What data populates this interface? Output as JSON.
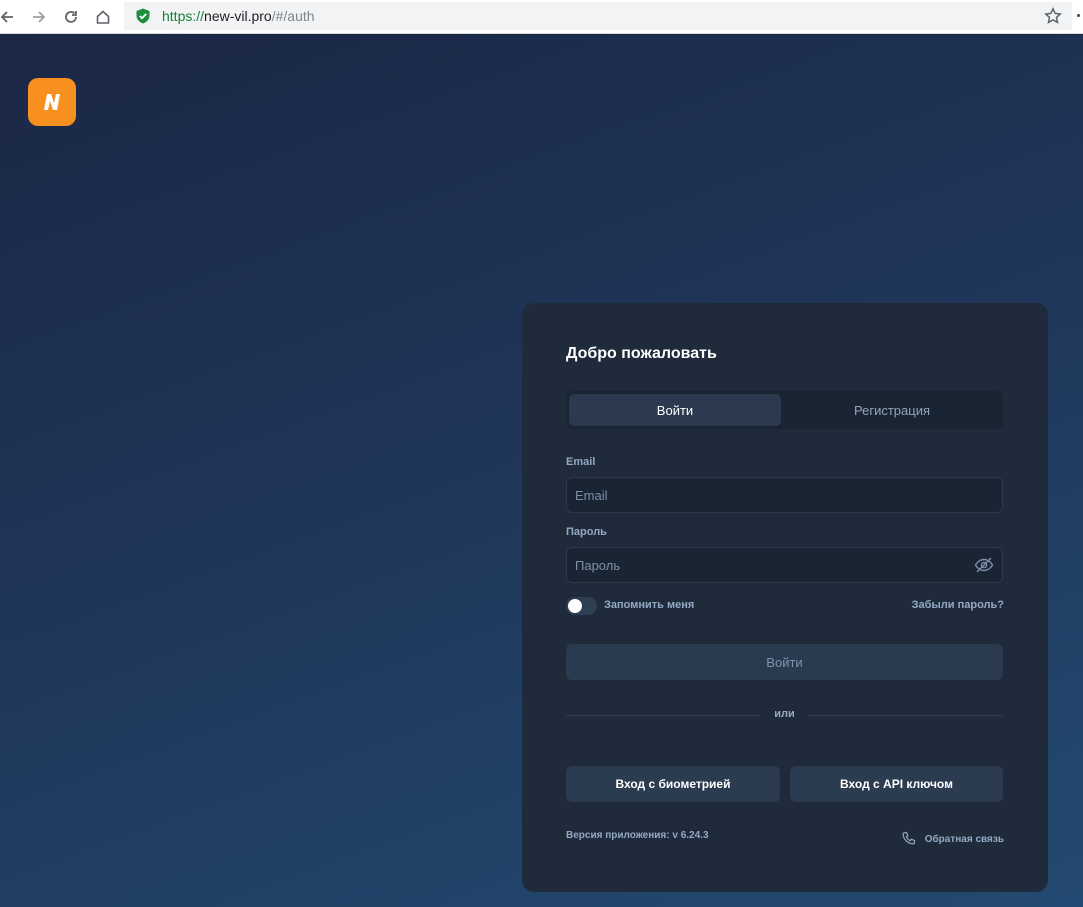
{
  "browser": {
    "url_scheme": "https://",
    "url_host": "new-vil.pro",
    "url_path": "/#/auth"
  },
  "auth": {
    "title": "Добро пожаловать",
    "tabs": {
      "login": "Войти",
      "register": "Регистрация"
    },
    "email_label": "Email",
    "email_placeholder": "Email",
    "password_label": "Пароль",
    "password_placeholder": "Пароль",
    "remember_label": "Запомнить меня",
    "remember_checked": false,
    "forgot_link": "Забыли пароль?",
    "submit_label": "Войти",
    "divider_text": "или",
    "biometric_button": "Вход с биометрией",
    "api_key_button": "Вход с API ключом",
    "version_text": "Версия приложения: v 6.24.3",
    "feedback_link": "Обратная связь"
  },
  "icons": {
    "logo": "brand-logo-icon",
    "eye": "eye-off-icon",
    "phone": "phone-icon"
  },
  "colors": {
    "accent": "#f7901e",
    "card": "#1f2b3a",
    "text_muted": "#93a9c4"
  }
}
